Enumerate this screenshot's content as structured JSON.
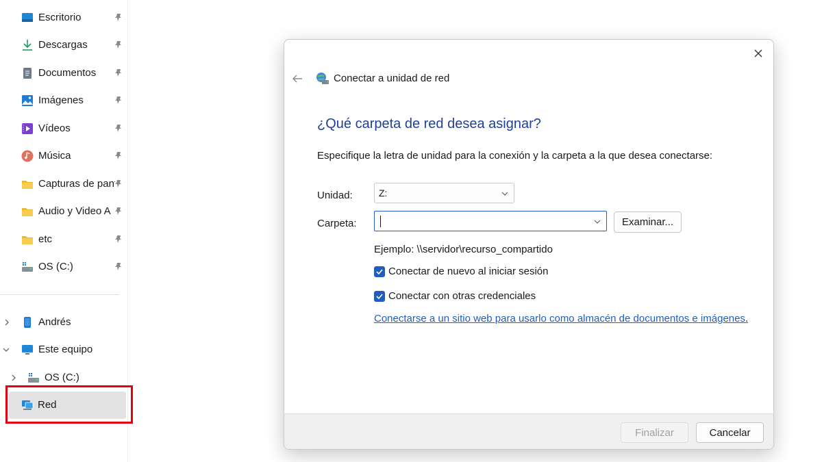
{
  "sidebar": {
    "quick_access": [
      {
        "label": "Escritorio",
        "icon": "desktop-icon"
      },
      {
        "label": "Descargas",
        "icon": "download-icon"
      },
      {
        "label": "Documentos",
        "icon": "document-icon"
      },
      {
        "label": "Imágenes",
        "icon": "pictures-icon"
      },
      {
        "label": "Vídeos",
        "icon": "videos-icon"
      },
      {
        "label": "Música",
        "icon": "music-icon"
      },
      {
        "label": "Capturas de pantalla",
        "icon": "folder-icon"
      },
      {
        "label": "Audio y Video A",
        "icon": "folder-icon"
      },
      {
        "label": "etc",
        "icon": "folder-icon"
      },
      {
        "label": "OS (C:)",
        "icon": "drive-icon"
      }
    ],
    "tree": [
      {
        "label": "Andrés",
        "icon": "phone-icon",
        "expander": "collapsed"
      },
      {
        "label": "Este equipo",
        "icon": "computer-icon",
        "expander": "expanded"
      },
      {
        "label": "OS (C:)",
        "icon": "drive-icon",
        "expander": "collapsed"
      },
      {
        "label": "Red",
        "icon": "network-icon",
        "selected": true
      }
    ]
  },
  "dialog": {
    "title": "Conectar a unidad de red",
    "question": "¿Qué carpeta de red desea asignar?",
    "description": "Especifique la letra de unidad para la conexión y la carpeta a la que desea conectarse:",
    "drive_label": "Unidad:",
    "drive_value": "Z:",
    "folder_label": "Carpeta:",
    "folder_value": "",
    "browse_label": "Examinar...",
    "example": "Ejemplo: \\\\servidor\\recurso_compartido",
    "checkbox_reconnect": {
      "label": "Conectar de nuevo al iniciar sesión",
      "checked": true
    },
    "checkbox_credentials": {
      "label": "Conectar con otras credenciales",
      "checked": true
    },
    "link": "Conectarse a un sitio web para usarlo como almacén de documentos e imágenes",
    "link_suffix": ".",
    "finish_label": "Finalizar",
    "cancel_label": "Cancelar"
  },
  "colors": {
    "accent": "#1f5ebf",
    "heading": "#1f3f9b",
    "highlight_box": "#e3000f"
  }
}
